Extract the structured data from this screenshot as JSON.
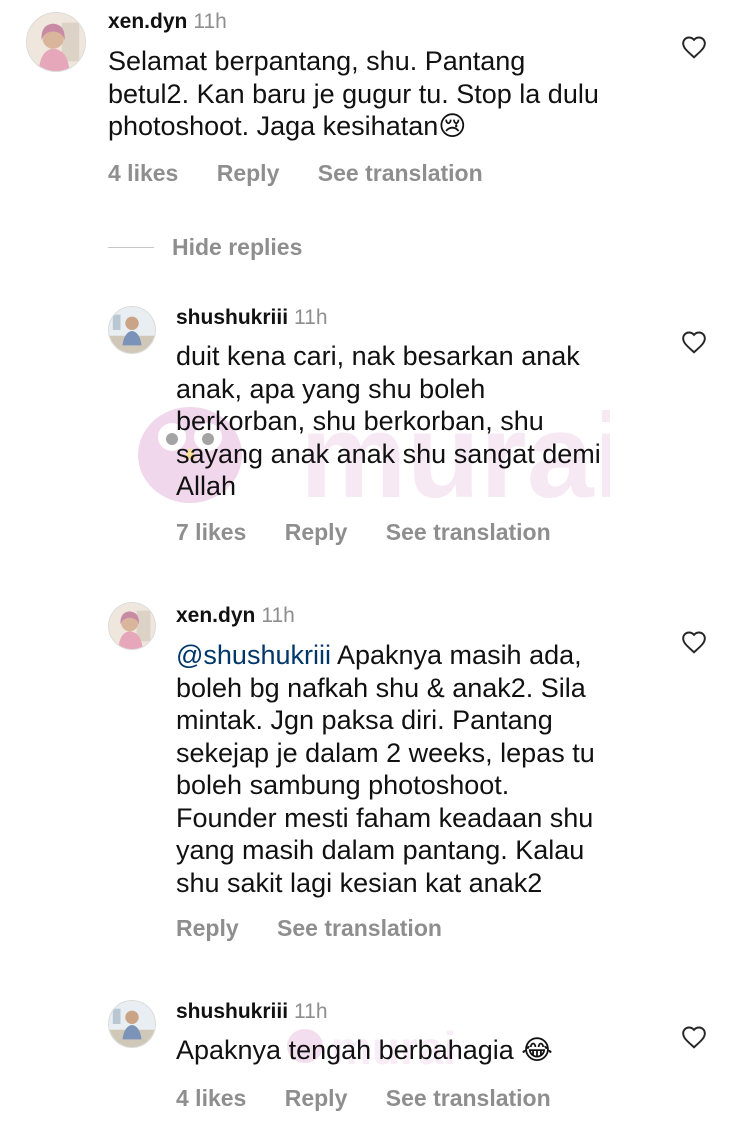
{
  "comments": [
    {
      "username": "xen.dyn",
      "time": "11h",
      "text": "Selamat berpantang, shu. Pantang\nbetul2. Kan baru je gugur tu. Stop la dulu\nphotoshoot. Jaga kesihatan😢",
      "likes": "4 likes",
      "reply": "Reply",
      "translate": "See translation"
    },
    {
      "username": "shushukriii",
      "time": "11h",
      "text": "duit kena cari, nak besarkan anak\nanak, apa yang shu boleh\nberkorban, shu berkorban, shu\nsayang anak anak shu sangat demi\nAllah",
      "likes": "7 likes",
      "reply": "Reply",
      "translate": "See translation"
    },
    {
      "username": "xen.dyn",
      "time": "11h",
      "mention": "@shushukriii",
      "text": " Apaknya masih ada,\nboleh bg nafkah shu & anak2. Sila\nmintak. Jgn paksa diri. Pantang\nsekejap je dalam 2 weeks, lepas tu\nboleh sambung photoshoot.\nFounder mesti faham keadaan shu\nyang masih dalam pantang. Kalau\nshu sakit lagi kesian kat anak2",
      "reply": "Reply",
      "translate": "See translation"
    },
    {
      "username": "shushukriii",
      "time": "11h",
      "text": "Apaknya tengah berbahagia 😂",
      "likes": "4 likes",
      "reply": "Reply",
      "translate": "See translation"
    }
  ],
  "hide_replies": "Hide replies",
  "watermark": "murai",
  "icons": {
    "like": "heart-outline-icon",
    "avatar_xen": "avatar-xen-dyn",
    "avatar_shu": "avatar-shushukriii"
  },
  "colors": {
    "secondary_text": "#8e8e8e",
    "mention": "#00376b",
    "watermark": "#f1d8ec"
  }
}
